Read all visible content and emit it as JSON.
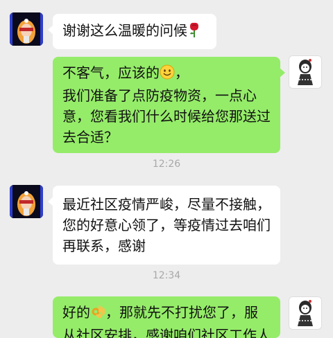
{
  "chat": {
    "msg1": {
      "text": "谢谢这么温暖的问候",
      "emoji": "rose-icon"
    },
    "msg2": {
      "line1": "不客气，应该的",
      "line1_emoji": "smile-icon",
      "line1_tail": "，",
      "line2": "我们准备了点防疫物资，一点心",
      "line3": "意，您看我们什么时候给您那送过",
      "line4": "去合适？"
    },
    "time1": "12:26",
    "msg3": {
      "line1": "最近社区疫情严峻，尽量不接触，",
      "line2": "您的好意心领了，等疫情过去咱们",
      "line3": "再联系，感谢"
    },
    "time2": "12:34",
    "msg4": {
      "line1_a": "好的",
      "line1_emoji": "ok-hand-icon",
      "line1_b": "，那就先不打扰您了，服",
      "line2": "从社区安排，感谢咱们社区工作人"
    }
  },
  "colors": {
    "background": "#ededed",
    "bubble_self": "#95ec69",
    "bubble_other": "#ffffff",
    "timestamp": "#a8a8a8"
  }
}
